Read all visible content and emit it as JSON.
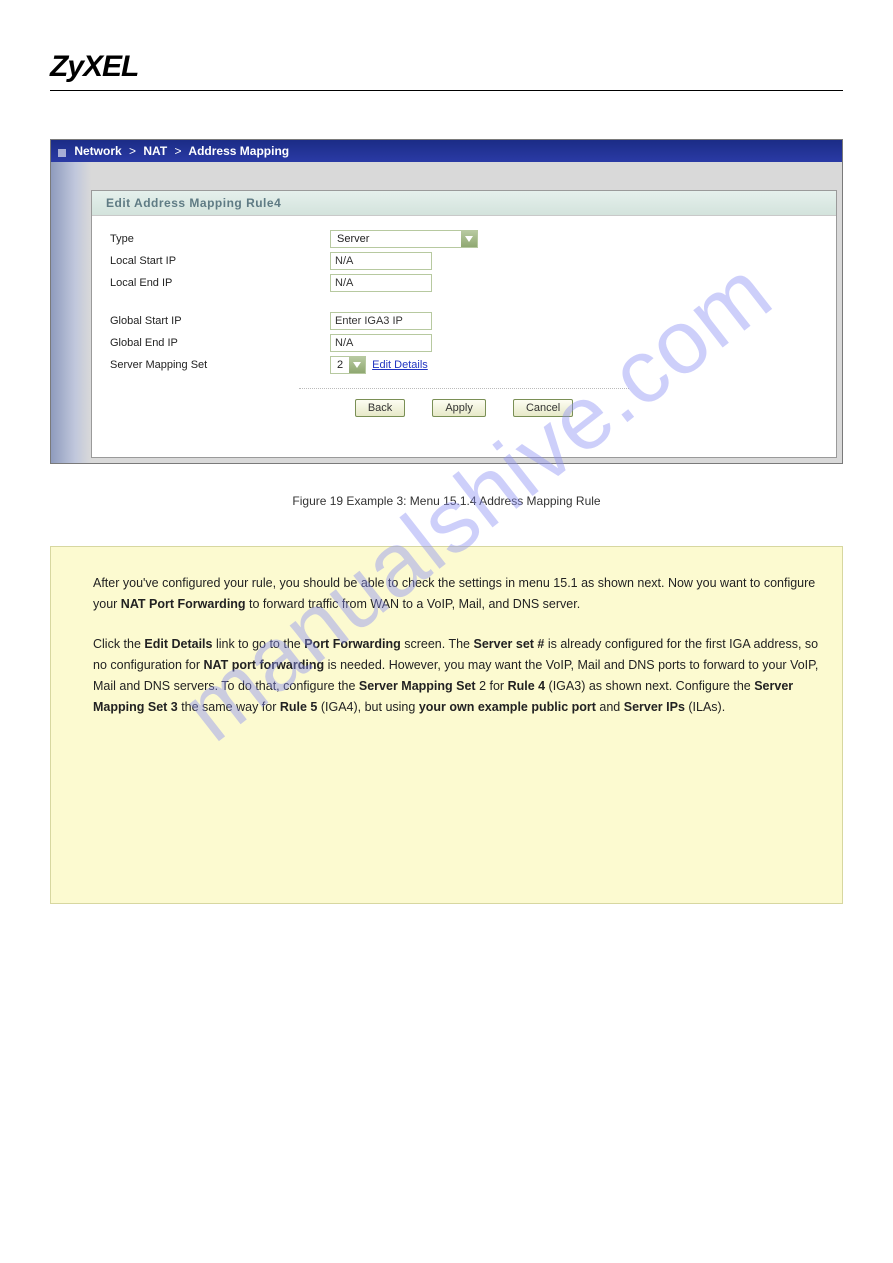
{
  "logo": "ZyXEL",
  "watermark": "manualshive.com",
  "screenshot": {
    "breadcrumb": {
      "a": "Network",
      "b": "NAT",
      "c": "Address Mapping"
    },
    "panelTitle": "Edit Address Mapping Rule4",
    "rows": {
      "type": {
        "label": "Type",
        "value": "Server"
      },
      "localStart": {
        "label": "Local Start IP",
        "value": "N/A"
      },
      "localEnd": {
        "label": "Local End IP",
        "value": "N/A"
      },
      "globalStart": {
        "label": "Global Start IP",
        "value": "Enter IGA3 IP"
      },
      "globalEnd": {
        "label": "Global End IP",
        "value": "N/A"
      },
      "serverSet": {
        "label": "Server Mapping Set",
        "value": "2",
        "link": "Edit Details"
      }
    },
    "buttons": {
      "back": "Back",
      "apply": "Apply",
      "cancel": "Cancel"
    }
  },
  "figcaption": "Figure 19 Example 3: Menu 15.1.4 Address Mapping Rule",
  "note": {
    "p1": [
      "After you've configured your rule, you should be able to check the settings in menu 15.1 as shown next. Now you want to configure your ",
      "NAT Port Forwarding",
      " to forward traffic from WAN to a VoIP, Mail, and DNS server."
    ],
    "p2": [
      "Click the ",
      "Edit Details",
      " link to go to the ",
      "Port Forwarding",
      " screen. The ",
      "Server set #",
      " is already configured for the first IGA address, so no configuration for ",
      "NAT port forwarding",
      " is needed. However, you may want the VoIP, Mail and DNS ports to forward to your VoIP, Mail and DNS servers. To do that, configure the ",
      "Server Mapping Set",
      " 2 for ",
      "Rule 4",
      " (IGA3) as shown next. Configure the ",
      "Server Mapping Set 3",
      " the same way for ",
      "Rule 5",
      " (IGA4), but using ",
      "your own example public port",
      " and ",
      "Server IPs",
      " (ILAs)."
    ]
  }
}
